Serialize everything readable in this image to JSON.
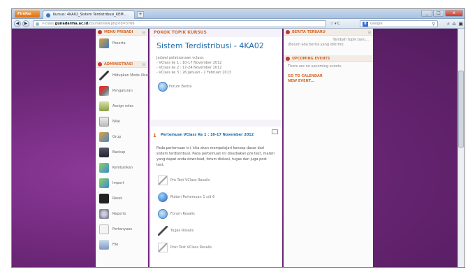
{
  "browser": {
    "app_button": "Firefox",
    "tab_title": "Kursus: 4KA02_Sistem Terdistribusi_KEM...",
    "new_tab": "+",
    "url_prefix": "v-class.",
    "url_domain": "gunadarma.ac.id",
    "url_path": "/course/view.php?id=3766",
    "search_engine": "8",
    "search_placeholder": "Google",
    "nav_icons": "☆ ▾ C",
    "search_mag": "⚲",
    "toolbar_icons": [
      "⌕",
      "⌂",
      "▣"
    ],
    "window_controls": [
      "_",
      "□",
      "x"
    ]
  },
  "left": {
    "menu_title": "MENU PRIBADI",
    "menu_items": [
      {
        "label": "Peserta"
      }
    ],
    "admin_title": "ADMINISTRASI",
    "admin_items": [
      {
        "label": "Hidupkan Mode Ubah"
      },
      {
        "label": "Pengaturan"
      },
      {
        "label": "Assign roles"
      },
      {
        "label": "Nilai"
      },
      {
        "label": "Grup"
      },
      {
        "label": "Backup"
      },
      {
        "label": "Kembalikan"
      },
      {
        "label": "Import"
      },
      {
        "label": "Reset"
      },
      {
        "label": "Reports"
      },
      {
        "label": "Pertanyaan"
      },
      {
        "label": "File"
      }
    ],
    "collapse_glyph": "⊟"
  },
  "middle": {
    "topic_header": "POKOK TOPIK KURSUS",
    "course_title": "Sistem Terdistribusi - 4KA02",
    "schedule_heading": "Jadwal pelaksanaan vclass:",
    "schedule": [
      "- VClass ke 1 : 10-17 November 2012",
      "- VClass ke 2 : 17-24 November 2012",
      "- VClass ke 3 : 26 Januari - 2 Februari 2013"
    ],
    "forum_label": "Forum Berita",
    "section_number": "1",
    "section_title": "Pertemuan VClass Ke 1 : 10-17 November 2012",
    "section_desc": "Pada pertemuan ini, kita akan mempelajari konsep dasar dari sistem terdistribusi. Pada pertemuan ini disediakan pre test, materi yang dapat anda download, forum diskusi, tugas dan juga post test.",
    "activities": [
      {
        "label": "Pre Test VClass Rosalis",
        "icon": "quiz-icon"
      },
      {
        "label": "Materi Pertemuan 1 s/d 6",
        "icon": "globe-icon"
      },
      {
        "label": "Forum Rosalis",
        "icon": "forum-icon"
      },
      {
        "label": "Tugas Rosalis",
        "icon": "assignment-icon"
      },
      {
        "label": "Post Test VClass Rosalis",
        "icon": "quiz-icon"
      }
    ]
  },
  "right": {
    "news_title": "BERITA TERBARU",
    "news_add": "Tambah topik baru...",
    "news_empty": "(Belum ada berita yang dikirim)",
    "events_title": "UPCOMING EVENTS",
    "events_empty": "There are no upcoming events",
    "goto_calendar": "GO TO CALENDAR",
    "new_event": "NEW EVENT..."
  }
}
